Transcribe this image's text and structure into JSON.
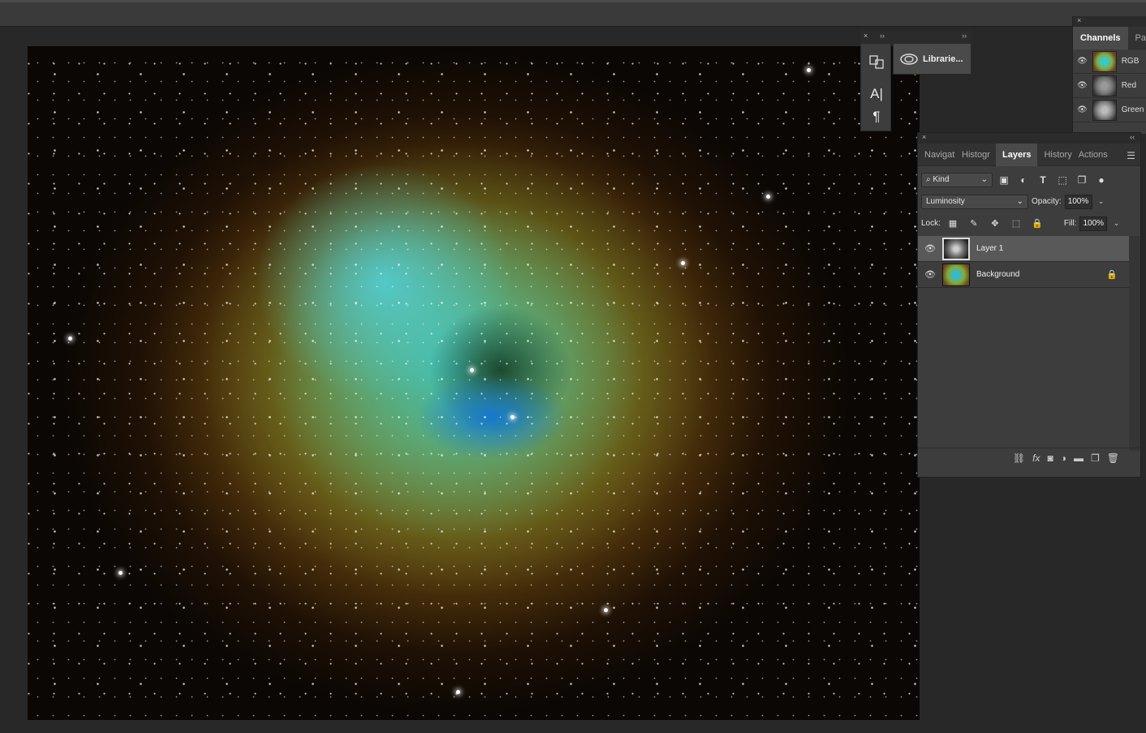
{
  "panels": {
    "mini": {
      "close": "×",
      "collapse": "››",
      "libraries_label": "Librarie..."
    },
    "channels": {
      "close": "×",
      "tabs": [
        "Channels",
        "Pat"
      ],
      "rows": [
        {
          "name": "RGB"
        },
        {
          "name": "Red"
        },
        {
          "name": "Green"
        }
      ]
    },
    "layers": {
      "close": "×",
      "collapse": "‹‹",
      "tabs": [
        "Navigat",
        "Histogr",
        "Layers",
        "History",
        "Actions"
      ],
      "filter_kind": "Kind",
      "blend_mode": "Luminosity",
      "opacity_label": "Opacity:",
      "opacity_value": "100%",
      "lock_label": "Lock:",
      "fill_label": "Fill:",
      "fill_value": "100%",
      "items": [
        {
          "name": "Layer 1",
          "selected": true
        },
        {
          "name": "Background",
          "locked": true
        }
      ]
    }
  },
  "icons": [
    "eye-icon",
    "lock-icon",
    "link-icon",
    "fx-icon",
    "mask-icon",
    "adjustment-icon",
    "folder-icon",
    "new-layer-icon",
    "trash-icon",
    "menu-icon",
    "cloud-icon",
    "character-icon",
    "paragraph-icon"
  ]
}
